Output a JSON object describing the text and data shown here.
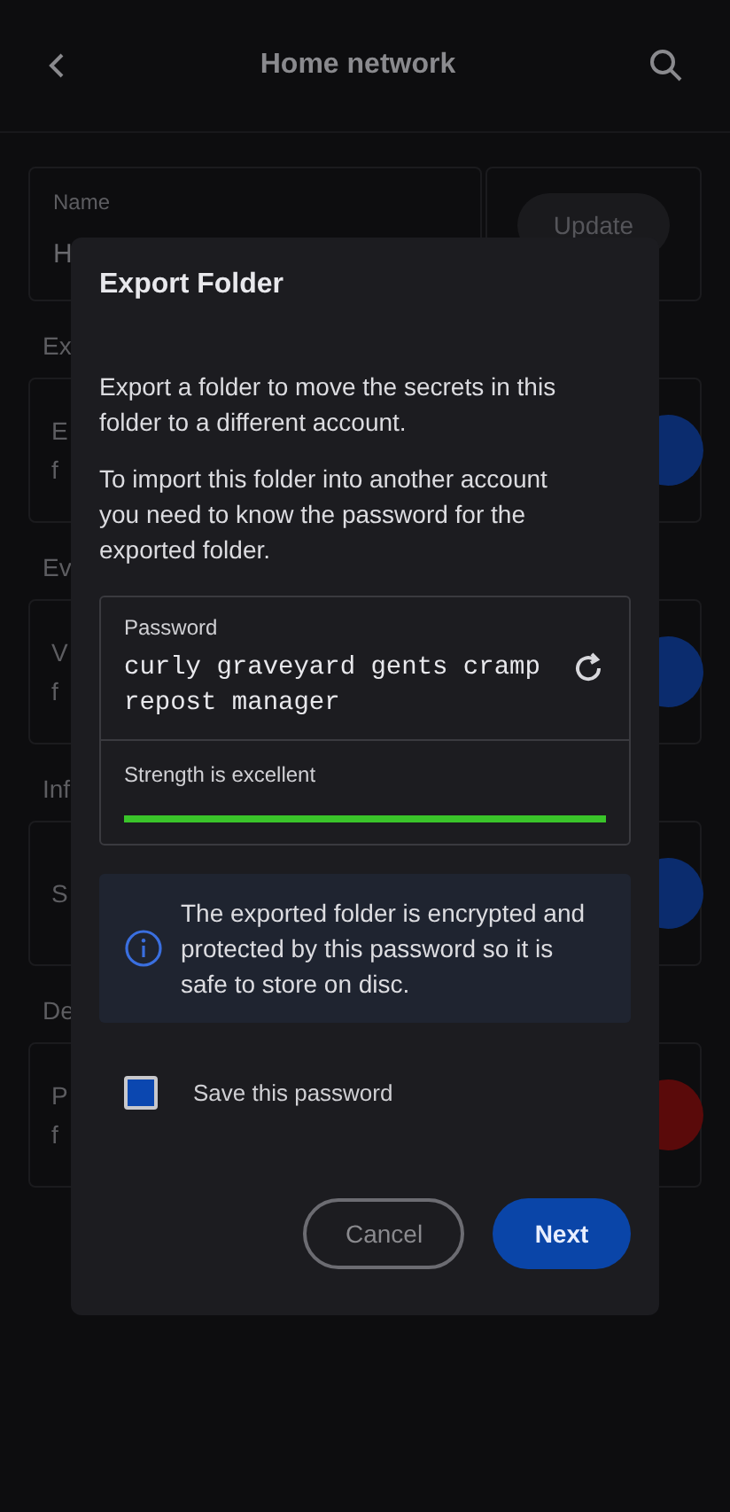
{
  "app_bar": {
    "title": "Home network"
  },
  "name_field": {
    "label": "Name",
    "value": "H"
  },
  "update_button": {
    "label": "Update",
    "disabled": true
  },
  "sections": [
    {
      "heading": "Ex",
      "lines": [
        "E",
        "f"
      ],
      "color": "#0b2c6e"
    },
    {
      "heading": "Ev",
      "lines": [
        "V",
        "f"
      ],
      "color": "#0b2c6e"
    },
    {
      "heading": "Inf",
      "lines": [
        "S"
      ],
      "color": "#0b2c6e"
    },
    {
      "heading": "De",
      "lines": [
        "P",
        "f"
      ],
      "color": "#5a0a0a"
    }
  ],
  "dialog": {
    "title": "Export Folder",
    "paragraphs": [
      "Export a folder to move the secrets in this folder to a different account.",
      "To import this folder into another account you need to know the password for the exported folder."
    ],
    "password": {
      "label": "Password",
      "value": "curly graveyard gents cramp repost manager",
      "strength": "Strength is excellent",
      "level": 1
    },
    "info": "The exported folder is encrypted and protected by this password so it is safe to store on disc.",
    "save_checkbox": {
      "label": "Save this password",
      "checked": true
    },
    "buttons": [
      {
        "label": "Cancel",
        "kind": "outlined"
      },
      {
        "label": "Next",
        "kind": "filled"
      }
    ]
  }
}
